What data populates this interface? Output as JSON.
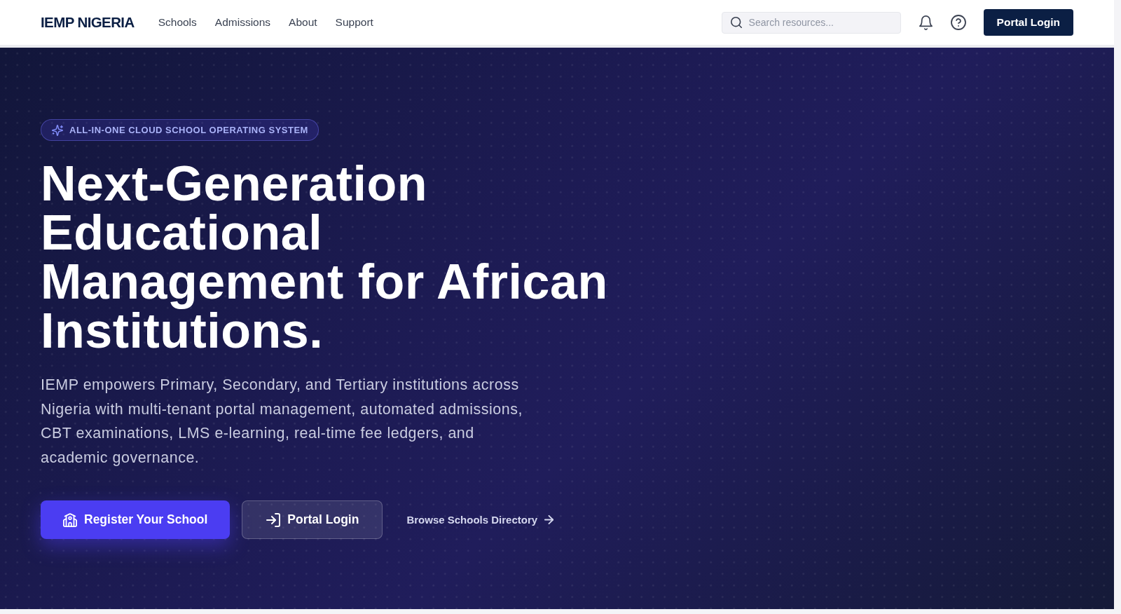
{
  "header": {
    "logo": "IEMP NIGERIA",
    "nav": [
      "Schools",
      "Admissions",
      "About",
      "Support"
    ],
    "search": {
      "placeholder": "Search resources..."
    },
    "login_button": "Portal Login"
  },
  "hero": {
    "badge": "ALL-IN-ONE CLOUD SCHOOL OPERATING SYSTEM",
    "headline": "Next-Generation Educational Management for African Institutions.",
    "description": "IEMP empowers Primary, Secondary, and Tertiary institutions across Nigeria with multi-tenant portal management, automated admissions, CBT examinations, LMS e-learning, real-time fee ledgers, and academic governance.",
    "actions": [
      {
        "kind": "primary",
        "label": "Register Your School"
      },
      {
        "kind": "secondary",
        "label": "Portal Login"
      },
      {
        "kind": "link",
        "label": "Browse Schools Directory"
      }
    ]
  }
}
